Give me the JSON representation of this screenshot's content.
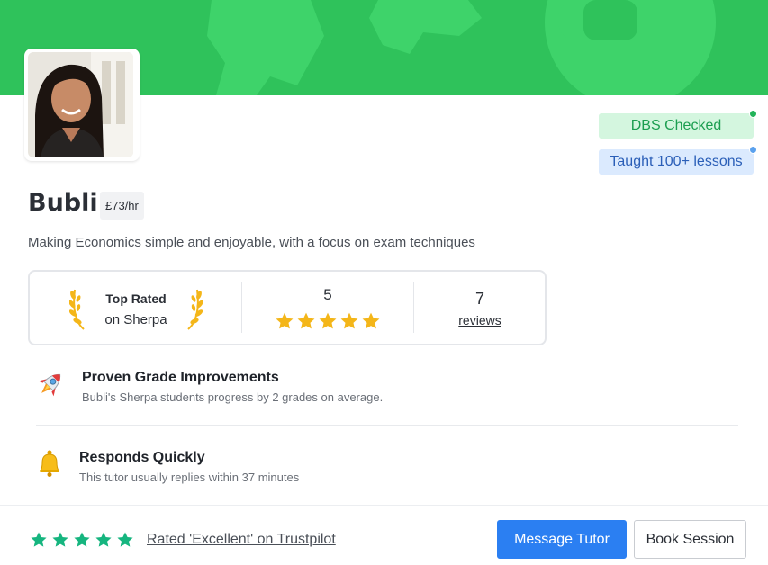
{
  "tutor": {
    "name": "Bubli",
    "price": "£73/hr",
    "tagline": "Making Economics simple and enjoyable, with a focus on exam techniques"
  },
  "badges": {
    "dbs": "DBS Checked",
    "taught": "Taught 100+ lessons"
  },
  "stats": {
    "top_rated_line1": "Top Rated",
    "top_rated_line2": "on Sherpa",
    "rating": "5",
    "rating_stars": 5,
    "reviews_count": "7",
    "reviews_label": "reviews"
  },
  "features": [
    {
      "icon": "rocket-icon",
      "title": "Proven Grade Improvements",
      "description": "Bubli's Sherpa students progress by 2 grades on average."
    },
    {
      "icon": "bell-icon",
      "title": "Responds Quickly",
      "description": "This tutor usually replies within 37 minutes"
    }
  ],
  "footer": {
    "trustpilot_stars": 5,
    "trustpilot_text": "Rated 'Excellent' on Trustpilot",
    "message_button": "Message Tutor",
    "book_button": "Book Session"
  },
  "colors": {
    "banner": "#2fc25b",
    "primary": "#2b7ff2",
    "star_gold": "#f4b619",
    "star_green": "#16b57f"
  }
}
